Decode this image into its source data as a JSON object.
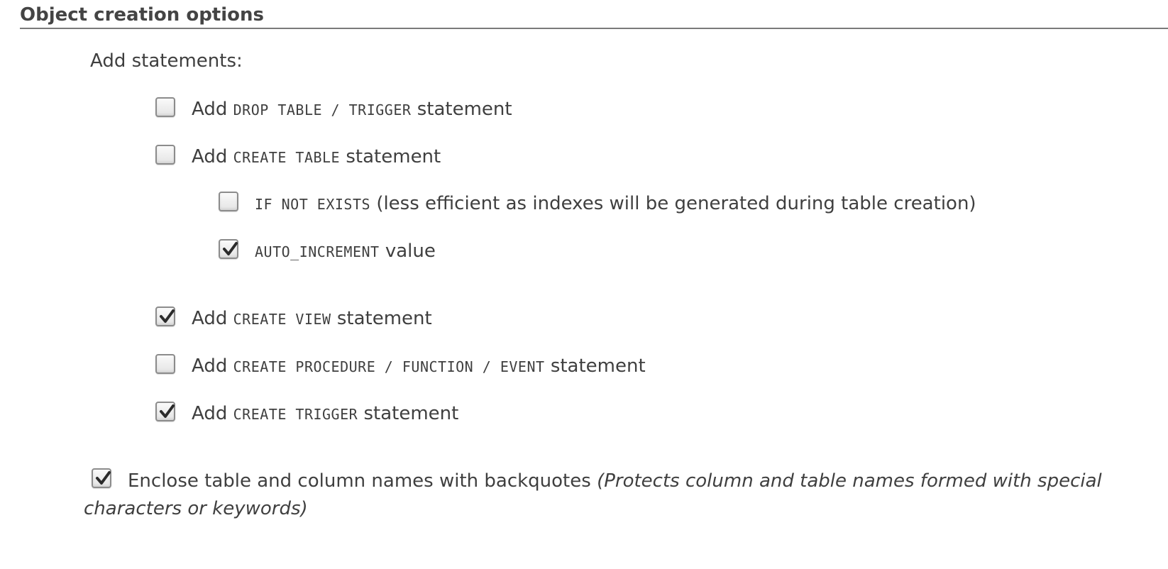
{
  "section": {
    "title": "Object creation options"
  },
  "add_statements_label": "Add statements:",
  "options": {
    "drop_table": {
      "checked": false,
      "prefix": "Add",
      "code": "DROP TABLE / TRIGGER",
      "suffix": "statement"
    },
    "create_table": {
      "checked": false,
      "prefix": "Add",
      "code": "CREATE TABLE",
      "suffix": "statement"
    },
    "if_not_exists": {
      "checked": false,
      "code": "IF NOT EXISTS",
      "suffix": "(less efficient as indexes will be generated during table creation)"
    },
    "auto_increment": {
      "checked": true,
      "code": "AUTO_INCREMENT",
      "suffix": "value"
    },
    "create_view": {
      "checked": true,
      "prefix": "Add",
      "code": "CREATE VIEW",
      "suffix": "statement"
    },
    "create_procedure": {
      "checked": false,
      "prefix": "Add",
      "code": "CREATE PROCEDURE / FUNCTION / EVENT",
      "suffix": "statement"
    },
    "create_trigger": {
      "checked": true,
      "prefix": "Add",
      "code": "CREATE TRIGGER",
      "suffix": "statement"
    },
    "backquotes": {
      "checked": true,
      "text": "Enclose table and column names with backquotes",
      "note_line1": "(Protects column and table names formed with special",
      "note_line2": "characters or keywords)"
    }
  }
}
